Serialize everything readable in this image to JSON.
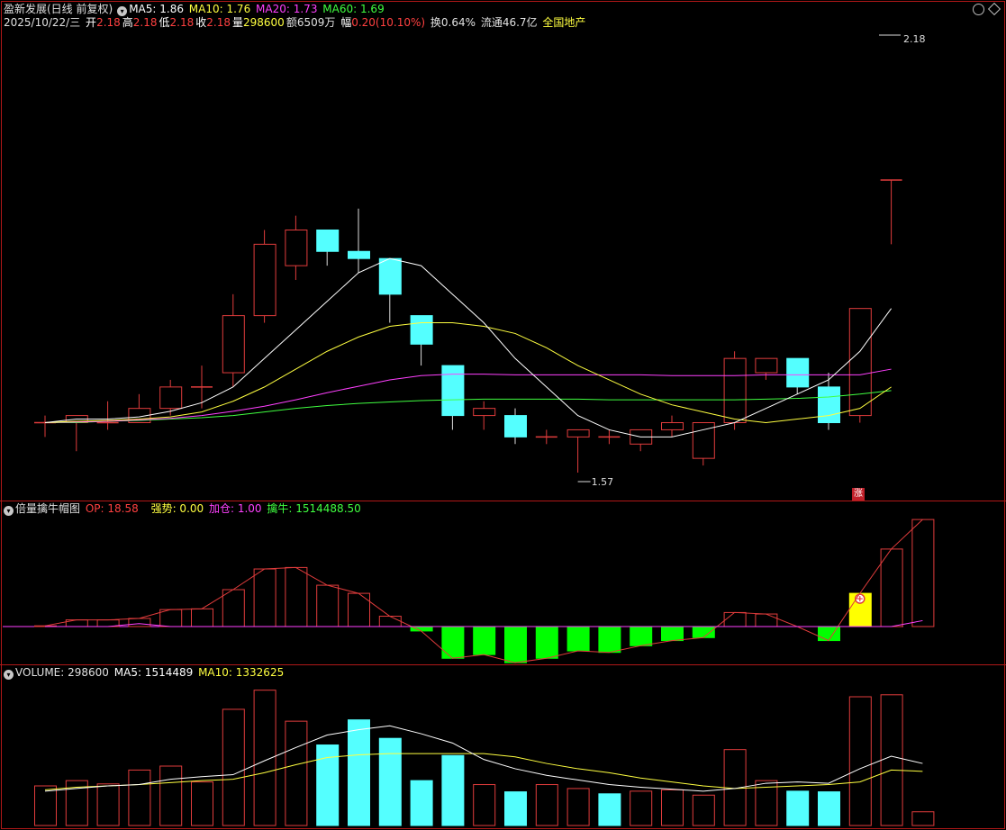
{
  "header": {
    "title": "盈新发展(日线 前复权)",
    "ma5": "MA5: 1.86",
    "ma10": "MA10: 1.76",
    "ma20": "MA20: 1.73",
    "ma60": "MA60: 1.69",
    "date": "2025/10/22/三",
    "open_label": "开",
    "open": "2.18",
    "high_label": "高",
    "high": "2.18",
    "low_label": "低",
    "low": "2.18",
    "close_label": "收",
    "close": "2.18",
    "vol_label": "量",
    "vol": "298600",
    "amt": "额6509万",
    "chg_label": "幅",
    "chg": "0.20(10.10%)",
    "turnover": "换0.64%",
    "float": "流通46.7亿",
    "sector": "全国地产",
    "max_mark": "2.18",
    "min_mark": "1.57",
    "limit_up_badge": "涨"
  },
  "indicator": {
    "name": "倍量擒牛帽图",
    "op": "OP: 18.58",
    "strong": "强势: 0.00",
    "add": "加仓: 1.00",
    "qn": "擒牛: 1514488.50"
  },
  "volume_panel": {
    "vol": "VOLUME: 298600",
    "ma5": "MA5: 1514489",
    "ma10": "MA10: 1332625"
  },
  "colors": {
    "up": "#e03c3c",
    "down": "#54ffff",
    "ma5": "#ffffff",
    "ma10": "#ffff40",
    "ma20": "#ff40ff",
    "ma60": "#40ff40",
    "pos_bar": "#e03c3c",
    "neg_bar": "#00ff00",
    "signal_bar": "#ffff00"
  },
  "chart_data": [
    {
      "type": "candlestick",
      "title": "盈新发展(日线 前复权)",
      "candles": [
        {
          "o": 1.64,
          "h": 1.65,
          "l": 1.62,
          "c": 1.64
        },
        {
          "o": 1.64,
          "h": 1.65,
          "l": 1.6,
          "c": 1.65
        },
        {
          "o": 1.64,
          "h": 1.67,
          "l": 1.63,
          "c": 1.64
        },
        {
          "o": 1.64,
          "h": 1.68,
          "l": 1.64,
          "c": 1.66
        },
        {
          "o": 1.66,
          "h": 1.7,
          "l": 1.65,
          "c": 1.69
        },
        {
          "o": 1.69,
          "h": 1.72,
          "l": 1.66,
          "c": 1.69
        },
        {
          "o": 1.71,
          "h": 1.82,
          "l": 1.69,
          "c": 1.79
        },
        {
          "o": 1.79,
          "h": 1.91,
          "l": 1.78,
          "c": 1.89
        },
        {
          "o": 1.86,
          "h": 1.93,
          "l": 1.84,
          "c": 1.91
        },
        {
          "o": 1.91,
          "h": 1.91,
          "l": 1.86,
          "c": 1.88
        },
        {
          "o": 1.88,
          "h": 1.94,
          "l": 1.85,
          "c": 1.87
        },
        {
          "o": 1.87,
          "h": 1.87,
          "l": 1.78,
          "c": 1.82
        },
        {
          "o": 1.79,
          "h": 1.79,
          "l": 1.72,
          "c": 1.75
        },
        {
          "o": 1.72,
          "h": 1.72,
          "l": 1.63,
          "c": 1.65
        },
        {
          "o": 1.65,
          "h": 1.67,
          "l": 1.63,
          "c": 1.66
        },
        {
          "o": 1.65,
          "h": 1.66,
          "l": 1.61,
          "c": 1.62
        },
        {
          "o": 1.62,
          "h": 1.63,
          "l": 1.61,
          "c": 1.62
        },
        {
          "o": 1.62,
          "h": 1.63,
          "l": 1.57,
          "c": 1.63
        },
        {
          "o": 1.62,
          "h": 1.63,
          "l": 1.61,
          "c": 1.62
        },
        {
          "o": 1.61,
          "h": 1.63,
          "l": 1.6,
          "c": 1.63
        },
        {
          "o": 1.63,
          "h": 1.65,
          "l": 1.62,
          "c": 1.64
        },
        {
          "o": 1.59,
          "h": 1.64,
          "l": 1.58,
          "c": 1.64
        },
        {
          "o": 1.64,
          "h": 1.74,
          "l": 1.63,
          "c": 1.73
        },
        {
          "o": 1.71,
          "h": 1.73,
          "l": 1.7,
          "c": 1.73
        },
        {
          "o": 1.73,
          "h": 1.73,
          "l": 1.68,
          "c": 1.69
        },
        {
          "o": 1.69,
          "h": 1.71,
          "l": 1.63,
          "c": 1.64
        },
        {
          "o": 1.65,
          "h": 1.8,
          "l": 1.64,
          "c": 1.8
        },
        {
          "o": 1.98,
          "h": 1.98,
          "l": 1.89,
          "c": 1.98
        }
      ],
      "ma5": [
        1.64,
        1.645,
        1.645,
        1.648,
        1.656,
        1.668,
        1.69,
        1.73,
        1.77,
        1.81,
        1.85,
        1.87,
        1.86,
        1.82,
        1.78,
        1.73,
        1.69,
        1.65,
        1.63,
        1.62,
        1.62,
        1.63,
        1.64,
        1.66,
        1.68,
        1.7,
        1.74,
        1.8,
        1.86
      ],
      "ma10": [
        1.64,
        1.642,
        1.643,
        1.645,
        1.648,
        1.655,
        1.67,
        1.69,
        1.715,
        1.74,
        1.76,
        1.775,
        1.78,
        1.78,
        1.775,
        1.765,
        1.745,
        1.72,
        1.7,
        1.68,
        1.665,
        1.655,
        1.645,
        1.64,
        1.645,
        1.65,
        1.66,
        1.69,
        1.76
      ],
      "ma20": [
        1.64,
        1.641,
        1.642,
        1.644,
        1.646,
        1.65,
        1.656,
        1.663,
        1.672,
        1.682,
        1.691,
        1.7,
        1.706,
        1.708,
        1.708,
        1.707,
        1.707,
        1.707,
        1.707,
        1.707,
        1.706,
        1.706,
        1.706,
        1.707,
        1.707,
        1.707,
        1.707,
        1.715,
        1.73
      ],
      "ma60": [
        1.64,
        1.64,
        1.642,
        1.643,
        1.645,
        1.647,
        1.65,
        1.655,
        1.66,
        1.664,
        1.667,
        1.669,
        1.671,
        1.672,
        1.673,
        1.673,
        1.673,
        1.673,
        1.672,
        1.672,
        1.672,
        1.672,
        1.672,
        1.673,
        1.674,
        1.676,
        1.68,
        1.685,
        1.69
      ],
      "max_label": 2.18,
      "min_label": 1.57
    },
    {
      "type": "bar",
      "title": "倍量擒牛帽图",
      "values": [
        0.1,
        0.9,
        0.9,
        1.1,
        2.3,
        2.4,
        5.0,
        7.8,
        8.0,
        5.6,
        4.5,
        1.4,
        -0.6,
        -4.3,
        -3.8,
        -4.9,
        -4.3,
        -3.3,
        -3.5,
        -2.6,
        -1.9,
        -1.5,
        1.9,
        1.7,
        0,
        -1.9,
        4.5,
        10.5,
        14.5
      ],
      "signal": [
        0,
        0,
        0,
        0,
        0,
        0,
        0,
        0,
        0,
        0,
        0,
        0,
        0,
        0,
        0,
        0,
        0,
        0,
        0,
        0,
        0,
        0,
        0,
        0,
        0,
        0,
        1,
        0,
        0
      ],
      "line": [
        0.1,
        0.9,
        0.9,
        1.1,
        2.3,
        2.4,
        5.0,
        7.8,
        8.0,
        5.6,
        4.5,
        1.4,
        -0.6,
        -4.3,
        -3.8,
        -4.9,
        -4.3,
        -3.3,
        -3.5,
        -2.6,
        -1.9,
        -1.5,
        1.9,
        1.7,
        0,
        -1.9,
        4.5,
        10.5,
        14.5
      ],
      "line2": [
        0,
        0,
        0,
        0.4,
        0,
        0,
        0,
        0,
        0,
        0,
        0,
        0,
        0,
        0,
        0,
        0,
        0,
        0,
        0,
        0,
        0,
        0,
        0,
        0,
        0,
        0,
        0,
        0,
        0.8
      ]
    },
    {
      "type": "bar",
      "title": "VOLUME",
      "values": [
        600000,
        680000,
        630000,
        840000,
        900000,
        660000,
        1760000,
        2050000,
        1580000,
        1220000,
        1600000,
        1320000,
        680000,
        1060000,
        620000,
        510000,
        620000,
        560000,
        480000,
        520000,
        540000,
        460000,
        1150000,
        680000,
        520000,
        510000,
        1950000,
        1980000,
        208000
      ],
      "up": [
        1,
        1,
        1,
        1,
        1,
        1,
        1,
        1,
        1,
        0,
        0,
        0,
        0,
        0,
        1,
        0,
        1,
        1,
        0,
        1,
        1,
        1,
        1,
        1,
        0,
        0,
        1,
        1,
        1
      ],
      "ma5": [
        520000,
        560000,
        600000,
        620000,
        700000,
        740000,
        770000,
        980000,
        1180000,
        1370000,
        1450000,
        1510000,
        1390000,
        1250000,
        1000000,
        860000,
        760000,
        690000,
        620000,
        580000,
        550000,
        520000,
        560000,
        640000,
        660000,
        640000,
        860000,
        1050000,
        940000
      ],
      "ma10": [
        540000,
        580000,
        600000,
        620000,
        650000,
        680000,
        700000,
        800000,
        920000,
        1030000,
        1070000,
        1090000,
        1090000,
        1090000,
        1090000,
        1040000,
        940000,
        860000,
        800000,
        720000,
        660000,
        600000,
        560000,
        580000,
        600000,
        620000,
        660000,
        840000,
        820000
      ],
      "ylim": [
        0,
        2250000
      ]
    }
  ]
}
